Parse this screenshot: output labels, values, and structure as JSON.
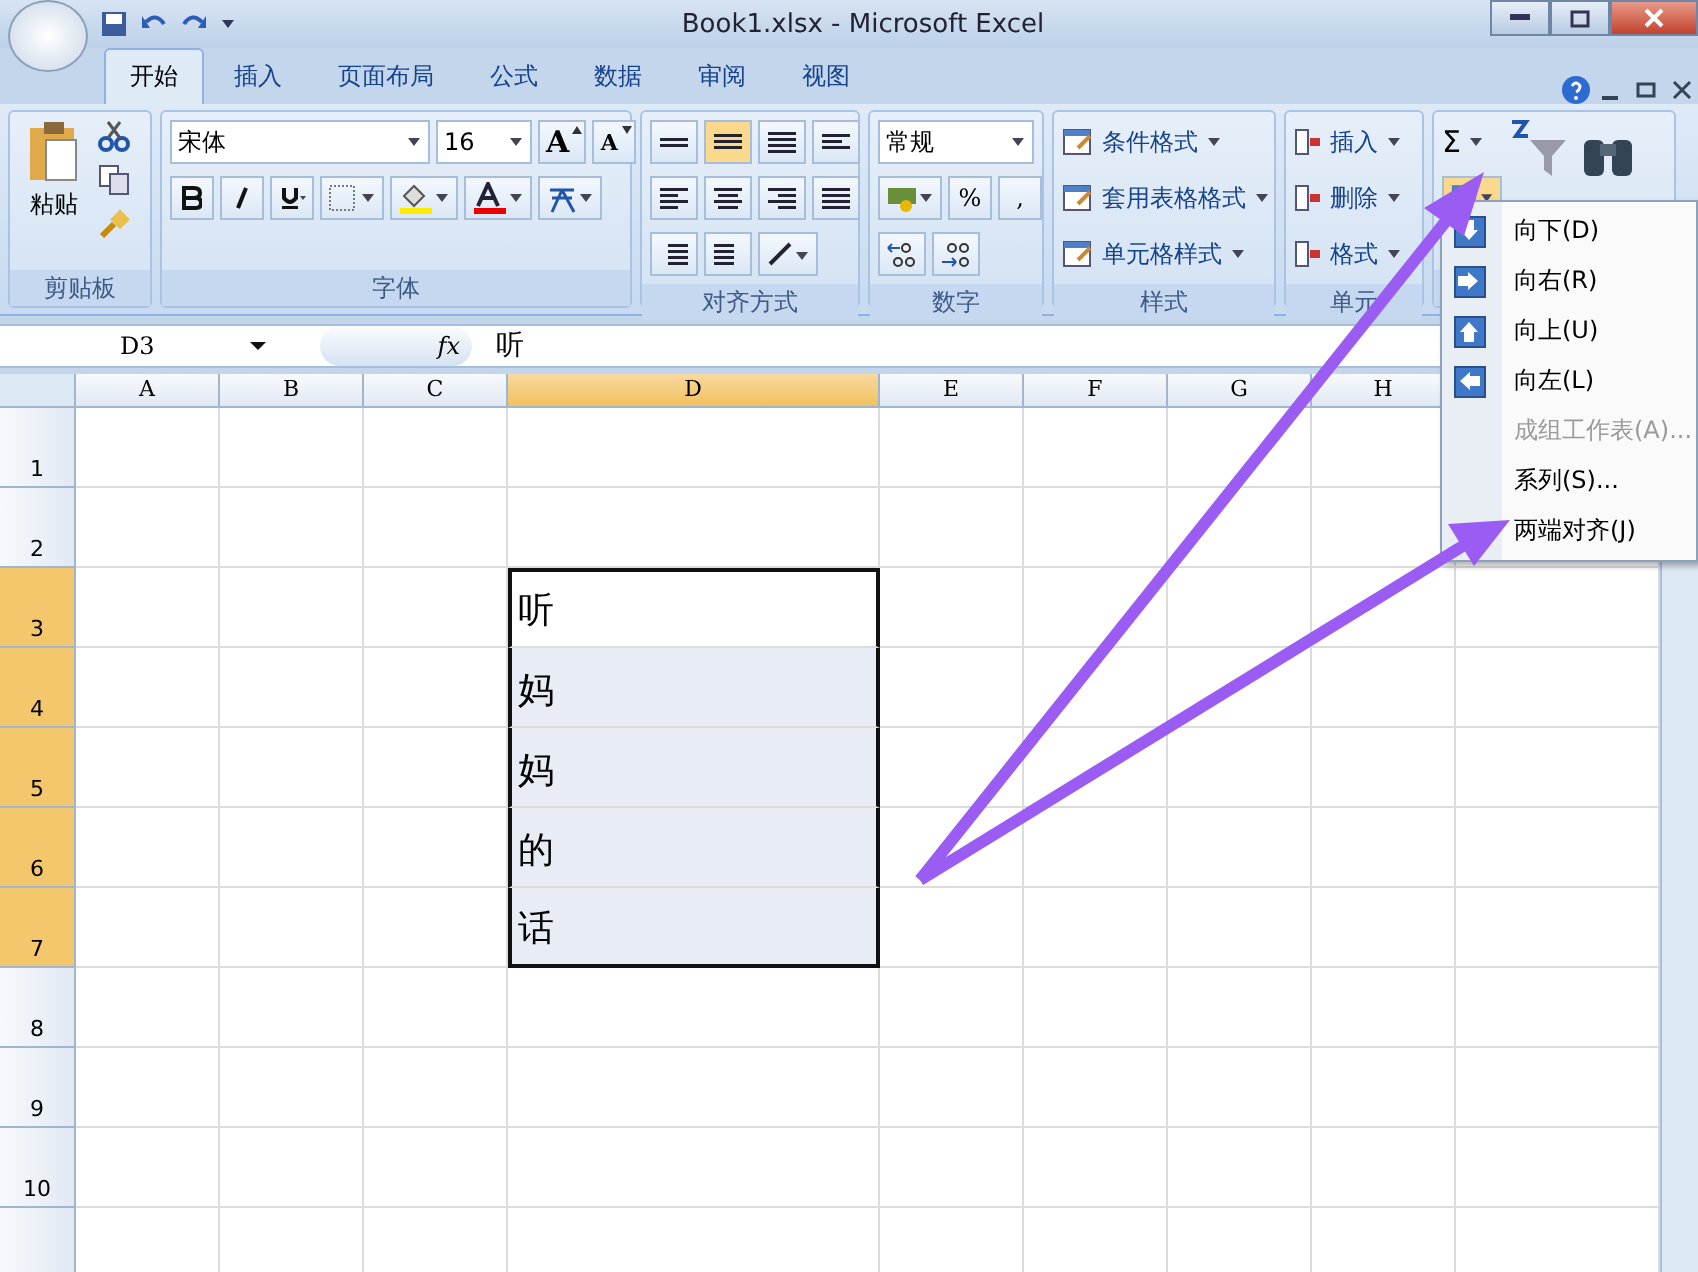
{
  "window": {
    "title": "Book1.xlsx - Microsoft Excel"
  },
  "tabs": [
    {
      "label": "开始",
      "selected": true
    },
    {
      "label": "插入",
      "selected": false
    },
    {
      "label": "页面布局",
      "selected": false
    },
    {
      "label": "公式",
      "selected": false
    },
    {
      "label": "数据",
      "selected": false
    },
    {
      "label": "审阅",
      "selected": false
    },
    {
      "label": "视图",
      "selected": false
    }
  ],
  "ribbon": {
    "clipboard": {
      "label": "剪贴板",
      "paste": "粘贴"
    },
    "font": {
      "label": "字体",
      "font_name": "宋体",
      "font_size": "16",
      "grow": "A",
      "shrink": "A"
    },
    "alignment": {
      "label": "对齐方式"
    },
    "number": {
      "label": "数字",
      "format": "常规",
      "percent": "%",
      "comma": ","
    },
    "styles": {
      "label": "样式",
      "items": [
        "条件格式",
        "套用表格格式",
        "单元格样式"
      ]
    },
    "cells": {
      "label": "单元",
      "items": [
        "插入",
        "删除",
        "格式"
      ]
    },
    "editing": {
      "sum": "Σ"
    }
  },
  "formula_bar": {
    "name_box": "D3",
    "function_label": "fx",
    "formula": "听"
  },
  "sheet": {
    "columns": [
      {
        "label": "A",
        "selected": false
      },
      {
        "label": "B",
        "selected": false
      },
      {
        "label": "C",
        "selected": false
      },
      {
        "label": "D",
        "selected": true
      },
      {
        "label": "E",
        "selected": false
      },
      {
        "label": "F",
        "selected": false
      },
      {
        "label": "G",
        "selected": false
      },
      {
        "label": "H",
        "selected": false
      }
    ],
    "rows": [
      {
        "label": "1",
        "selected": false
      },
      {
        "label": "2",
        "selected": false
      },
      {
        "label": "3",
        "selected": true,
        "value": "听"
      },
      {
        "label": "4",
        "selected": true,
        "value": "妈"
      },
      {
        "label": "5",
        "selected": true,
        "value": "妈"
      },
      {
        "label": "6",
        "selected": true,
        "value": "的"
      },
      {
        "label": "7",
        "selected": true,
        "value": "话"
      },
      {
        "label": "8",
        "selected": false
      },
      {
        "label": "9",
        "selected": false
      },
      {
        "label": "10",
        "selected": false
      }
    ]
  },
  "fill_menu": {
    "items": [
      {
        "label": "向下(D)",
        "kind": "down",
        "disabled": false
      },
      {
        "label": "向右(R)",
        "kind": "right",
        "disabled": false
      },
      {
        "label": "向上(U)",
        "kind": "up",
        "disabled": false
      },
      {
        "label": "向左(L)",
        "kind": "left",
        "disabled": false
      },
      {
        "label": "成组工作表(A)...",
        "kind": "plain",
        "disabled": true
      },
      {
        "label": "系列(S)...",
        "kind": "plain",
        "disabled": false
      },
      {
        "label": "两端对齐(J)",
        "kind": "plain",
        "disabled": false
      }
    ]
  }
}
